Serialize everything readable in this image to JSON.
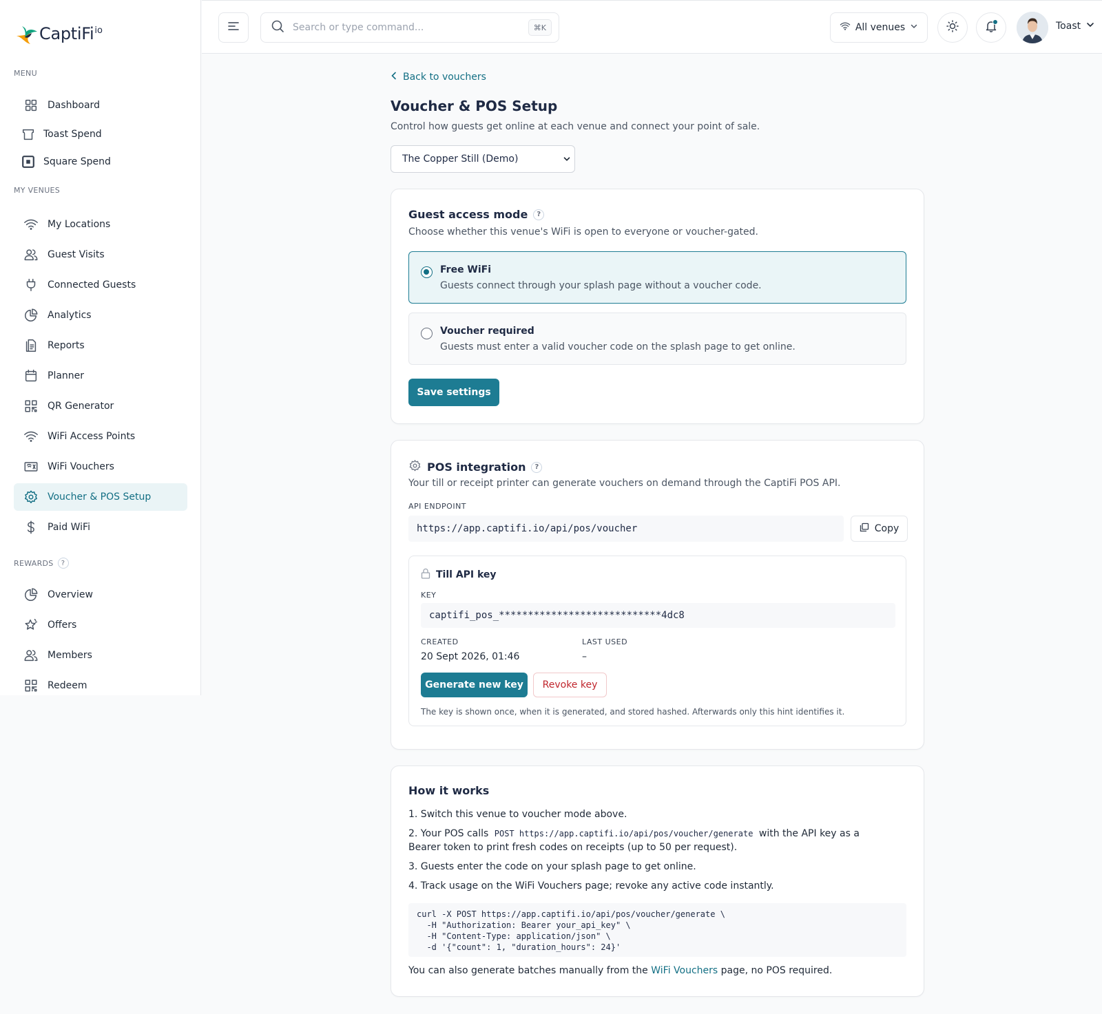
{
  "brand": {
    "name": "CaptiFi",
    "suffix": "io"
  },
  "sidebar": {
    "menu_label": "MENU",
    "menu_items": [
      {
        "label": "Dashboard",
        "icon": "grid-icon"
      },
      {
        "label": "Toast Spend",
        "icon": "toast-icon"
      },
      {
        "label": "Square Spend",
        "icon": "square-icon"
      }
    ],
    "venues_label": "MY VENUES",
    "venue_items": [
      {
        "label": "My Locations",
        "icon": "wifi-icon"
      },
      {
        "label": "Guest Visits",
        "icon": "users-icon"
      },
      {
        "label": "Connected Guests",
        "icon": "plug-icon"
      },
      {
        "label": "Analytics",
        "icon": "pie-chart-icon"
      },
      {
        "label": "Reports",
        "icon": "report-icon"
      },
      {
        "label": "Planner",
        "icon": "calendar-icon"
      },
      {
        "label": "QR Generator",
        "icon": "qr-icon"
      },
      {
        "label": "WiFi Access Points",
        "icon": "wifi-icon"
      },
      {
        "label": "WiFi Vouchers",
        "icon": "ticket-icon"
      },
      {
        "label": "Voucher & POS Setup",
        "icon": "gear-icon",
        "active": true
      },
      {
        "label": "Paid WiFi",
        "icon": "dollar-icon"
      }
    ],
    "rewards_label": "REWARDS",
    "rewards_help": "?",
    "reward_items": [
      {
        "label": "Overview",
        "icon": "pie-chart-icon"
      },
      {
        "label": "Offers",
        "icon": "star-icon"
      },
      {
        "label": "Members",
        "icon": "users-icon"
      },
      {
        "label": "Redeem",
        "icon": "qr-icon"
      }
    ]
  },
  "topbar": {
    "search_placeholder": "Search or type command...",
    "search_shortcut": "⌘K",
    "venue_filter": "All venues",
    "user_name": "Toast"
  },
  "page": {
    "back_link": "Back to vouchers",
    "title": "Voucher & POS Setup",
    "subtitle": "Control how guests get online at each venue and connect your point of sale.",
    "selected_venue": "The Copper Still (Demo)"
  },
  "guest_access": {
    "title": "Guest access mode",
    "help": "?",
    "subtitle": "Choose whether this venue's WiFi is open to everyone or voucher-gated.",
    "options": [
      {
        "title": "Free WiFi",
        "desc": "Guests connect through your splash page without a voucher code.",
        "selected": true
      },
      {
        "title": "Voucher required",
        "desc": "Guests must enter a valid voucher code on the splash page to get online.",
        "selected": false
      }
    ],
    "save_label": "Save settings"
  },
  "pos": {
    "title": "POS integration",
    "help": "?",
    "subtitle": "Your till or receipt printer can generate vouchers on demand through the CaptiFi POS API.",
    "endpoint_label": "API ENDPOINT",
    "endpoint": "https://app.captifi.io/api/pos/voucher",
    "copy_label": "Copy",
    "key_card": {
      "title": "Till API key",
      "key_label": "KEY",
      "key_value": "captifi_pos_****************************4dc8",
      "created_label": "CREATED",
      "created_value": "20 Sept 2026, 01:46",
      "last_used_label": "LAST USED",
      "last_used_value": "–",
      "generate_label": "Generate new key",
      "revoke_label": "Revoke key",
      "note": "The key is shown once, when it is generated, and stored hashed. Afterwards only this hint identifies it."
    }
  },
  "how_it_works": {
    "title": "How it works",
    "step1": "1. Switch this venue to voucher mode above.",
    "step2_prefix": "2. Your POS calls",
    "step2_code": "POST https://app.captifi.io/api/pos/voucher/generate",
    "step2_suffix": "with the API key as a Bearer token to print fresh codes on receipts (up to 50 per request).",
    "step3": "3. Guests enter the code on your splash page to get online.",
    "step4": "4. Track usage on the WiFi Vouchers page; revoke any active code instantly.",
    "curl": "curl -X POST https://app.captifi.io/api/pos/voucher/generate \\\n  -H \"Authorization: Bearer your_api_key\" \\\n  -H \"Content-Type: application/json\" \\\n  -d '{\"count\": 1, \"duration_hours\": 24}'",
    "footer_prefix": "You can also generate batches manually from the",
    "footer_link": "WiFi Vouchers",
    "footer_suffix": "page, no POS required."
  },
  "colors": {
    "accent": "#1d7c93",
    "danger": "#c0262d"
  }
}
